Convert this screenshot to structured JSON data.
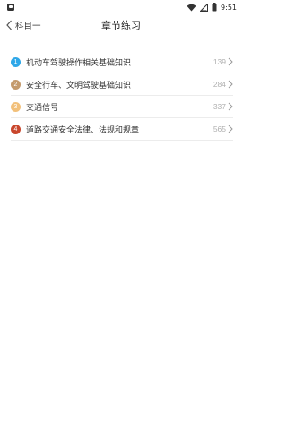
{
  "status_bar": {
    "time": "9:51",
    "icons": [
      "app-notification-icon",
      "wifi-icon",
      "signal-icon",
      "battery-icon"
    ]
  },
  "header": {
    "back_label": "科目一",
    "title": "章节练习"
  },
  "chapters": [
    {
      "number": "1",
      "title": "机动车驾驶操作相关基础知识",
      "count": "139",
      "color": "#2ea7e8"
    },
    {
      "number": "2",
      "title": "安全行车、文明驾驶基础知识",
      "count": "284",
      "color": "#c49a6c"
    },
    {
      "number": "3",
      "title": "交通信号",
      "count": "337",
      "color": "#f2c07a"
    },
    {
      "number": "4",
      "title": "道路交通安全法律、法规和规章",
      "count": "565",
      "color": "#c9472d"
    }
  ],
  "colors": {
    "badge_1": "#2ea7e8",
    "badge_2": "#c49a6c",
    "badge_3": "#f2c07a",
    "badge_4": "#c9472d",
    "count_text": "#b0b0b0"
  }
}
